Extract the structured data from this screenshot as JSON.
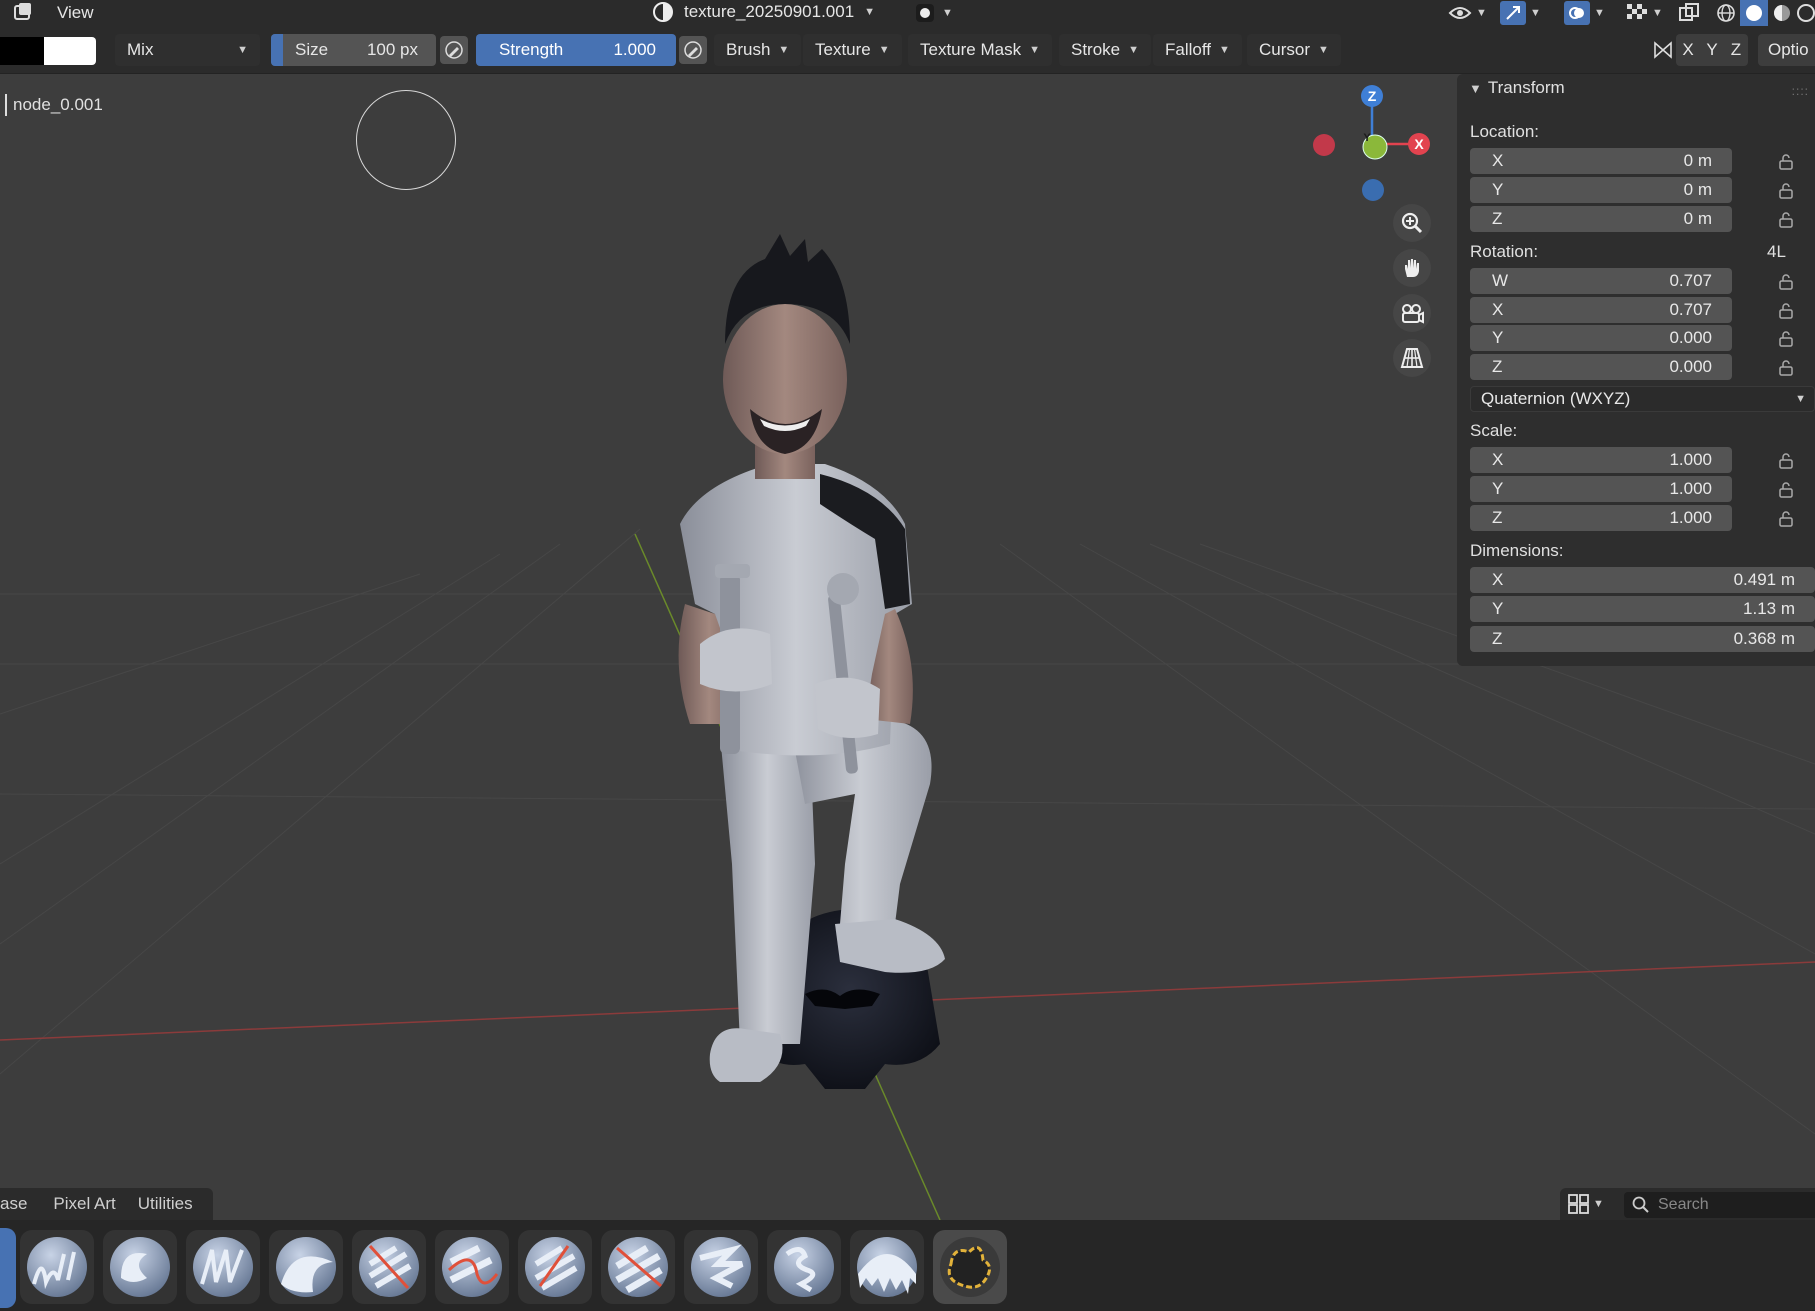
{
  "topbar": {
    "view_menu": "View",
    "image_name": "texture_20250901.001"
  },
  "toolbar": {
    "blend_mode": "Mix",
    "size_label": "Size",
    "size_value": "100 px",
    "strength_label": "Strength",
    "strength_value": "1.000",
    "menus": [
      "Brush",
      "Texture",
      "Texture Mask",
      "Stroke",
      "Falloff",
      "Cursor"
    ],
    "axis_x": "X",
    "axis_y": "Y",
    "axis_z": "Z",
    "options": "Optio"
  },
  "viewport": {
    "object_name": "node_0.001",
    "gizmo": {
      "x": "X",
      "y": "Y",
      "z": "Z"
    }
  },
  "transform": {
    "title": "Transform",
    "location_label": "Location:",
    "location": [
      {
        "axis": "X",
        "value": "0 m"
      },
      {
        "axis": "Y",
        "value": "0 m"
      },
      {
        "axis": "Z",
        "value": "0 m"
      }
    ],
    "rotation_label": "Rotation:",
    "rotation_flag": "4L",
    "rotation": [
      {
        "axis": "W",
        "value": "0.707"
      },
      {
        "axis": "X",
        "value": "0.707"
      },
      {
        "axis": "Y",
        "value": "0.000"
      },
      {
        "axis": "Z",
        "value": "0.000"
      }
    ],
    "rotation_mode": "Quaternion (WXYZ)",
    "scale_label": "Scale:",
    "scale": [
      {
        "axis": "X",
        "value": "1.000"
      },
      {
        "axis": "Y",
        "value": "1.000"
      },
      {
        "axis": "Z",
        "value": "1.000"
      }
    ],
    "dimensions_label": "Dimensions:",
    "dimensions": [
      {
        "axis": "X",
        "value": "0.491 m"
      },
      {
        "axis": "Y",
        "value": "1.13 m"
      },
      {
        "axis": "Z",
        "value": "0.368 m"
      }
    ]
  },
  "shelf": {
    "tabs": [
      "ase",
      "Pixel Art",
      "Utilities"
    ],
    "search_placeholder": "Search"
  },
  "colors": {
    "accent": "#4772b3",
    "x_axis": "#e2434f",
    "y_axis": "#8bb83a",
    "z_axis": "#3f7fd6"
  }
}
